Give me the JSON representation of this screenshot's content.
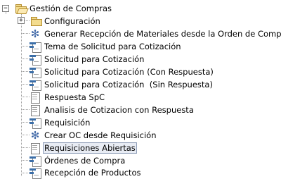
{
  "tree": {
    "root": {
      "label": "Gestión de Compras",
      "icon": "folder-open-icon",
      "expanded": true
    },
    "items": [
      {
        "label": "Configuración",
        "icon": "folder-icon",
        "collapsed": true
      },
      {
        "label": "Generar Recepción de Materiales desde la Orden de Compra",
        "icon": "gear-icon"
      },
      {
        "label": "Tema de Solicitud para Cotización",
        "icon": "form-icon"
      },
      {
        "label": "Solicitud para Cotización",
        "icon": "form-icon"
      },
      {
        "label": "Solicitud para Cotización (Con Respuesta)",
        "icon": "form-icon"
      },
      {
        "label": "Solicitud para Cotización  (Sin Respuesta)",
        "icon": "form-icon"
      },
      {
        "label": "Respuesta SpC",
        "icon": "document-icon"
      },
      {
        "label": "Analisis de Cotizacion con Respuesta",
        "icon": "document-icon"
      },
      {
        "label": "Requisición",
        "icon": "form-icon"
      },
      {
        "label": "Crear OC desde Requisición",
        "icon": "gear-icon"
      },
      {
        "label": "Requisiciones Abiertas",
        "icon": "document-icon",
        "selected": true
      },
      {
        "label": "Órdenes de Compra",
        "icon": "form-icon"
      },
      {
        "label": "Recepción de Productos",
        "icon": "form-icon"
      }
    ]
  },
  "toggles": {
    "expanded_symbol": "−",
    "collapsed_symbol": "+"
  }
}
